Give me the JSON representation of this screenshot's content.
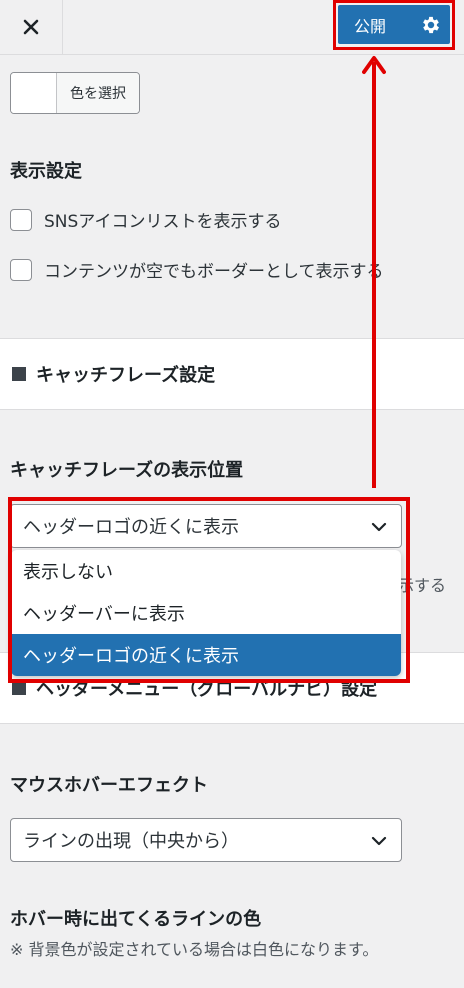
{
  "header": {
    "close_icon": "close-icon",
    "publish_label": "公開",
    "settings_icon": "gear-icon"
  },
  "color_picker": {
    "label": "色を選択"
  },
  "display_settings": {
    "heading": "表示設定",
    "options": [
      {
        "label": "SNSアイコンリストを表示する",
        "checked": false
      },
      {
        "label": "コンテンツが空でもボーダーとして表示する",
        "checked": false
      }
    ]
  },
  "section_catchphrase": {
    "title": "キャッチフレーズ設定"
  },
  "catchphrase_position": {
    "label": "キャッチフレーズの表示位置",
    "selected": "ヘッダーロゴの近くに表示",
    "options": [
      {
        "label": "表示しない"
      },
      {
        "label": "ヘッダーバーに表示"
      },
      {
        "label": "ヘッダーロゴの近くに表示",
        "selected": true
      }
    ],
    "partial_text": "示する"
  },
  "section_header_menu": {
    "title": "ヘッダーメニュー（グローバルナビ）設定"
  },
  "mouse_hover": {
    "label": "マウスホバーエフェクト",
    "selected": "ラインの出現（中央から）"
  },
  "hover_line_color": {
    "label": "ホバー時に出てくるラインの色",
    "note": "※ 背景色が設定されている場合は白色になります。"
  },
  "colors": {
    "accent": "#2271b1",
    "annotation_red": "#e00000",
    "background": "#f0f0f1"
  }
}
